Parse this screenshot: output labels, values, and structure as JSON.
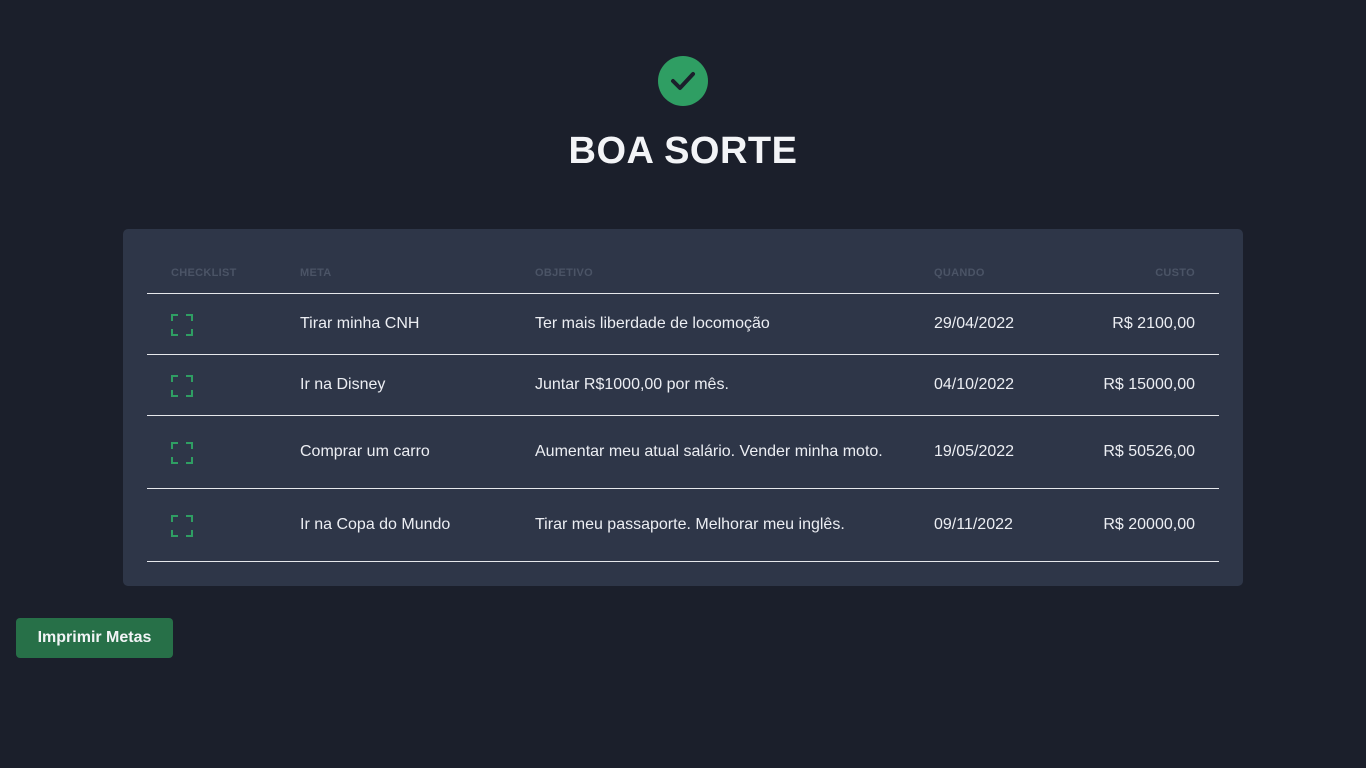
{
  "header": {
    "icon": "check-circle-icon",
    "title": "BOA SORTE"
  },
  "table": {
    "columns": {
      "checklist": "CHECKLIST",
      "meta": "META",
      "objetivo": "OBJETIVO",
      "quando": "QUANDO",
      "custo": "CUSTO"
    },
    "rows": [
      {
        "meta": "Tirar minha CNH",
        "objetivo": "Ter mais liberdade de locomoção",
        "quando": "29/04/2022",
        "custo": "R$ 2100,00"
      },
      {
        "meta": "Ir na Disney",
        "objetivo": "Juntar R$1000,00 por mês.",
        "quando": "04/10/2022",
        "custo": "R$ 15000,00"
      },
      {
        "meta": "Comprar um carro",
        "objetivo": "Aumentar meu atual salário. Vender minha moto.",
        "quando": "19/05/2022",
        "custo": "R$ 50526,00"
      },
      {
        "meta": "Ir na Copa do Mundo",
        "objetivo": "Tirar meu passaporte. Melhorar meu inglês.",
        "quando": "09/11/2022",
        "custo": "R$ 20000,00"
      }
    ]
  },
  "actions": {
    "print_label": "Imprimir Metas"
  },
  "colors": {
    "background": "#1b1f2b",
    "card": "#2e3648",
    "accent": "#2f9e63",
    "button": "#277048"
  }
}
